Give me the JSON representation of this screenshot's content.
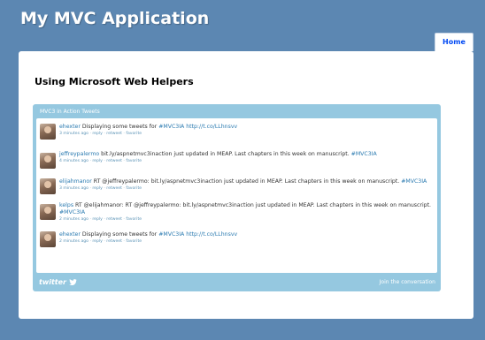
{
  "app": {
    "title": "My MVC Application"
  },
  "nav": {
    "home_label": "Home"
  },
  "main": {
    "heading": "Using Microsoft Web Helpers"
  },
  "widget": {
    "header": "MVC3 in Action Tweets",
    "footer_logo": "twitter",
    "join_label": "Join the conversation",
    "tweets": [
      {
        "author": "ehexter",
        "text": " Displaying some tweets for ",
        "tag": "#MVC3IA",
        "tail": "",
        "link": " http://t.co/LLhnsvv",
        "time": "3 minutes ago",
        "reply": "reply",
        "retweet": "retweet",
        "favorite": "favorite"
      },
      {
        "author": "jeffreypalermo",
        "text": " bit.ly/aspnetmvc3inaction just updated in MEAP. Last chapters in this week on manuscript. ",
        "tag": "#MVC3IA",
        "tail": "",
        "link": "",
        "time": "4 minutes ago",
        "reply": "reply",
        "retweet": "retweet",
        "favorite": "favorite"
      },
      {
        "author": "elijahmanor",
        "text": " RT @jeffreypalermo: bit.ly/aspnetmvc3inaction just updated in MEAP. Last chapters in this week on manuscript. ",
        "tag": "#MVC3IA",
        "tail": "",
        "link": "",
        "time": "3 minutes ago",
        "reply": "reply",
        "retweet": "retweet",
        "favorite": "favorite"
      },
      {
        "author": "kelps",
        "text": " RT @elijahmanor: RT @jeffreypalermo: bit.ly/aspnetmvc3inaction just updated in MEAP. Last chapters in this week on manuscript. ",
        "tag": "#MVC3IA",
        "tail": "",
        "link": "",
        "time": "2 minutes ago",
        "reply": "reply",
        "retweet": "retweet",
        "favorite": "favorite"
      },
      {
        "author": "ehexter",
        "text": " Displaying some tweets for ",
        "tag": "#MVC3IA",
        "tail": "",
        "link": " http://t.co/LLhnsvv",
        "time": "2 minutes ago",
        "reply": "reply",
        "retweet": "retweet",
        "favorite": "favorite"
      }
    ]
  },
  "colors": {
    "page_bg": "#5c87b2",
    "widget_bg": "#95c8e0",
    "link": "#2a7ab0",
    "nav_text": "#034af3"
  },
  "icons": {
    "footer_bird": "twitter-bird-icon",
    "avatars": "user-avatar"
  }
}
